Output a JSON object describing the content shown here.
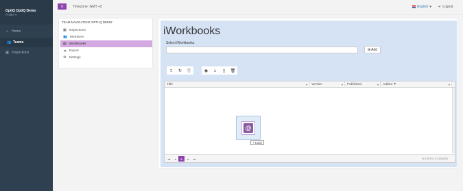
{
  "sidebar": {
    "user_name": "OptiQ OptiQ Demo",
    "profile_label": "Profile ▾",
    "items": [
      {
        "label": "Home",
        "icon": "home-icon"
      },
      {
        "label": "Teams",
        "icon": "users-icon"
      },
      {
        "label": "Inspections",
        "icon": "calendar-icon"
      }
    ]
  },
  "topbar": {
    "menu_icon": "hamburger-icon",
    "timezone": "Timezone: GMT +2",
    "language": "English",
    "logout": "Logout"
  },
  "subnav": {
    "header": "TEAM NAVIGATION 'OPTI-Q DEMO'",
    "items": [
      {
        "label": "Inspections",
        "icon": "calendar-icon"
      },
      {
        "label": "Members",
        "icon": "users-icon"
      },
      {
        "label": "iWorkbooks",
        "icon": "book-icon"
      },
      {
        "label": "Export",
        "icon": "cloud-icon"
      },
      {
        "label": "Settings",
        "icon": "gear-icon"
      }
    ]
  },
  "main": {
    "title": "iWorkbooks",
    "select_label": "Select iWorkbooks",
    "add_label": "Add",
    "grid": {
      "columns": [
        "Title",
        "Version",
        "Published",
        "Added ▼"
      ],
      "current_page": "0",
      "no_items": "No items to display"
    },
    "drag_tooltip": "Copy"
  },
  "colors": {
    "sidebar_bg": "#2f4050",
    "accent": "#8e44ad",
    "active_subnav": "#d4a8e0",
    "content_bg": "#d6e3f5"
  }
}
